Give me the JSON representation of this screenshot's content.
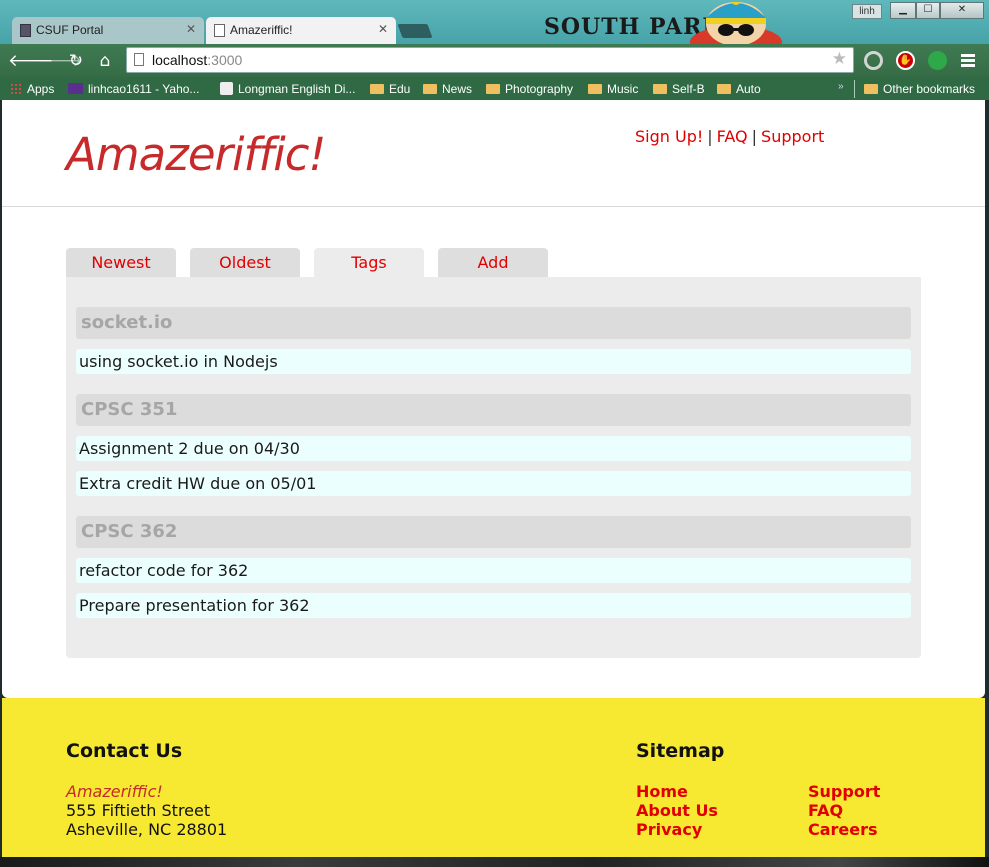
{
  "browser": {
    "tabs": [
      {
        "title": "CSUF Portal",
        "active": false
      },
      {
        "title": "Amazeriffic!",
        "active": true
      }
    ],
    "banner_text": "SOUTH PARK",
    "user_label": "linh",
    "url_host": "localhost",
    "url_port": ":3000",
    "bookmarks": [
      {
        "label": "Apps",
        "icon": "apps-grid-icon"
      },
      {
        "label": "linhcao1611 - Yaho...",
        "icon": "mail-icon"
      },
      {
        "label": "Longman English Di...",
        "icon": "dictionary-icon"
      },
      {
        "label": "Edu",
        "icon": "folder-icon"
      },
      {
        "label": "News",
        "icon": "folder-icon"
      },
      {
        "label": "Photography",
        "icon": "folder-icon"
      },
      {
        "label": "Music",
        "icon": "folder-icon"
      },
      {
        "label": "Self-B",
        "icon": "folder-icon"
      },
      {
        "label": "Auto",
        "icon": "folder-icon"
      }
    ],
    "overflow_label": "»",
    "other_bookmarks": "Other bookmarks"
  },
  "header": {
    "logo": "Amazeriffic!",
    "nav": [
      "Sign Up!",
      "FAQ",
      "Support"
    ],
    "nav_separator": "|"
  },
  "tabs": [
    {
      "label": "Newest",
      "active": false
    },
    {
      "label": "Oldest",
      "active": false
    },
    {
      "label": "Tags",
      "active": true
    },
    {
      "label": "Add",
      "active": false
    }
  ],
  "tag_groups": [
    {
      "tag": "socket.io",
      "items": [
        "using socket.io in Nodejs"
      ]
    },
    {
      "tag": "CPSC 351",
      "items": [
        "Assignment 2 due on 04/30",
        "Extra credit HW due on 05/01"
      ]
    },
    {
      "tag": "CPSC 362",
      "items": [
        "refactor code for 362",
        "Prepare presentation for 362"
      ]
    }
  ],
  "footer": {
    "contact_heading": "Contact Us",
    "contact_brand": "Amazeriffic!",
    "address_line1": "555 Fiftieth Street",
    "address_line2": "Asheville, NC 28801",
    "sitemap_heading": "Sitemap",
    "links": [
      "Home",
      "About Us",
      "Privacy",
      "Support",
      "FAQ",
      "Careers"
    ]
  },
  "colors": {
    "accent_red": "#e00000",
    "logo_red": "#c62a2a",
    "footer_yellow": "#f7e831",
    "item_bg": "#ecffff",
    "chrome_green": "#3f7a52"
  }
}
